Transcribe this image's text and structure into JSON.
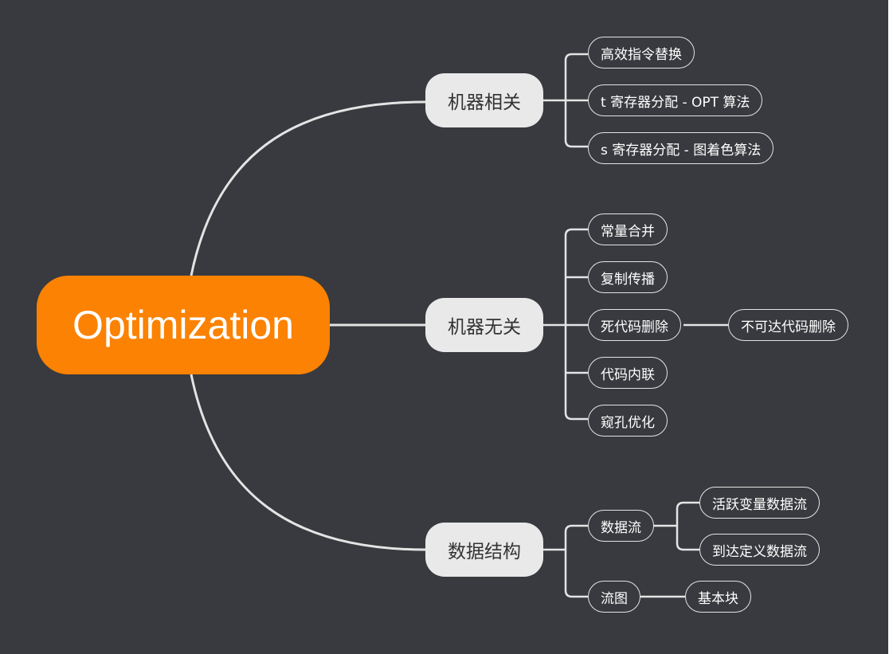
{
  "root": {
    "label": "Optimization"
  },
  "branches": [
    {
      "label": "机器相关",
      "children": [
        {
          "label": "高效指令替换"
        },
        {
          "label": "t 寄存器分配 - OPT 算法"
        },
        {
          "label": "s 寄存器分配 - 图着色算法"
        }
      ]
    },
    {
      "label": "机器无关",
      "children": [
        {
          "label": "常量合并"
        },
        {
          "label": "复制传播"
        },
        {
          "label": "死代码删除",
          "children": [
            {
              "label": "不可达代码删除"
            }
          ]
        },
        {
          "label": "代码内联"
        },
        {
          "label": "窥孔优化"
        }
      ]
    },
    {
      "label": "数据结构",
      "children": [
        {
          "label": "数据流",
          "children": [
            {
              "label": "活跃变量数据流"
            },
            {
              "label": "到达定义数据流"
            }
          ]
        },
        {
          "label": "流图",
          "children": [
            {
              "label": "基本块"
            }
          ]
        }
      ]
    }
  ],
  "colors": {
    "background": "#383a3f",
    "root": "#fb8203",
    "main_node": "#e9e9e9",
    "connector": "#e4e4e4"
  }
}
